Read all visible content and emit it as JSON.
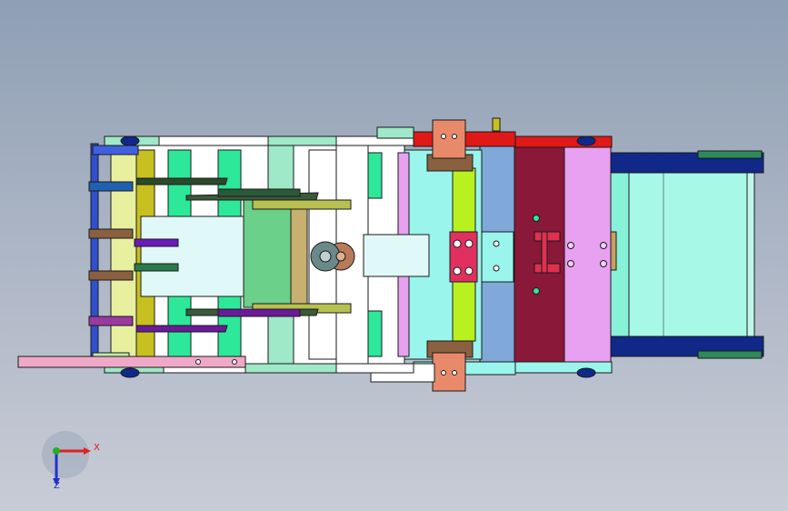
{
  "axes": {
    "x_label": "X",
    "z_label": "Z",
    "colors": {
      "x": "#e02020",
      "y": "#20b020",
      "z": "#2030d0"
    }
  },
  "model": {
    "view": "top-orthographic",
    "components": [
      "main-frame",
      "left-guide-rail",
      "feed-plate",
      "knob-assembly",
      "slide-block",
      "center-bracket",
      "clamp-tab-top",
      "clamp-tab-bottom",
      "magenta-block",
      "lavender-plate",
      "conveyor-belt"
    ],
    "colors": {
      "frame_outline": "#1a1a1a",
      "mint": "#9fe8c8",
      "green": "#2ee89a",
      "cyan": "#9af5ec",
      "aqua": "#7ff2d8",
      "olive": "#c8c020",
      "lime": "#b8f020",
      "steel_blue": "#80a8d8",
      "maroon": "#8a1838",
      "lavender": "#e8a0f0",
      "red": "#e01818",
      "navy": "#102888",
      "salmon": "#e88a6a",
      "brown": "#8a6040",
      "purple": "#6a1a9a",
      "pink": "#f0a8c8"
    }
  }
}
